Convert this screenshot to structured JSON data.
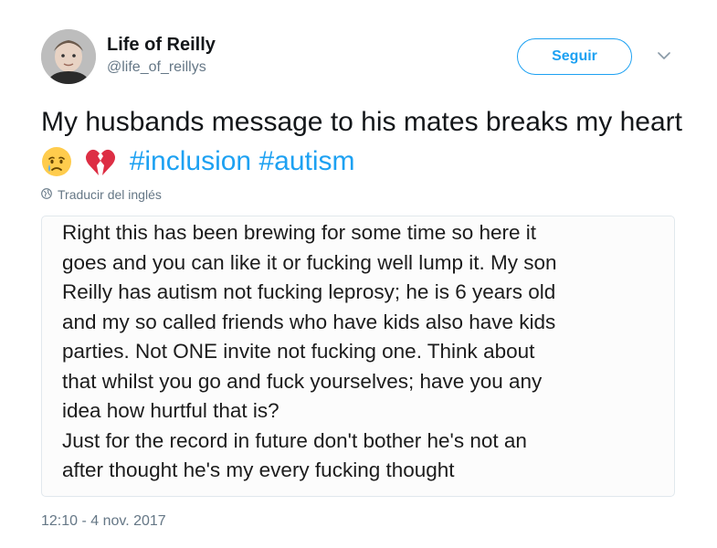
{
  "user": {
    "display_name": "Life of Reilly",
    "handle": "@life_of_reillys"
  },
  "follow_button": {
    "label": "Seguir"
  },
  "tweet": {
    "text_part1": "My husbands message to his mates  breaks my heart",
    "emojis": [
      "crying-face-emoji",
      "broken-heart-emoji"
    ],
    "hashtags": [
      "#inclusion",
      "#autism"
    ],
    "translate_label": "Traducir del inglés"
  },
  "attached_image": {
    "text": "Right this has been brewing for some time so here it\ngoes and you can like it or fucking well lump it. My son\nReilly has autism not fucking leprosy; he is 6 years old\nand my so called friends who have kids also have kids\nparties. Not ONE invite not fucking one. Think about\nthat whilst you go and fuck yourselves; have you any\nidea how hurtful that is?\nJust for the record in future don't bother he's not an\nafter thought he's my every fucking thought"
  },
  "timestamp": "12:10 - 4 nov. 2017",
  "colors": {
    "accent": "#1da1f2",
    "secondary_text": "#657786",
    "primary_text": "#14171a"
  }
}
